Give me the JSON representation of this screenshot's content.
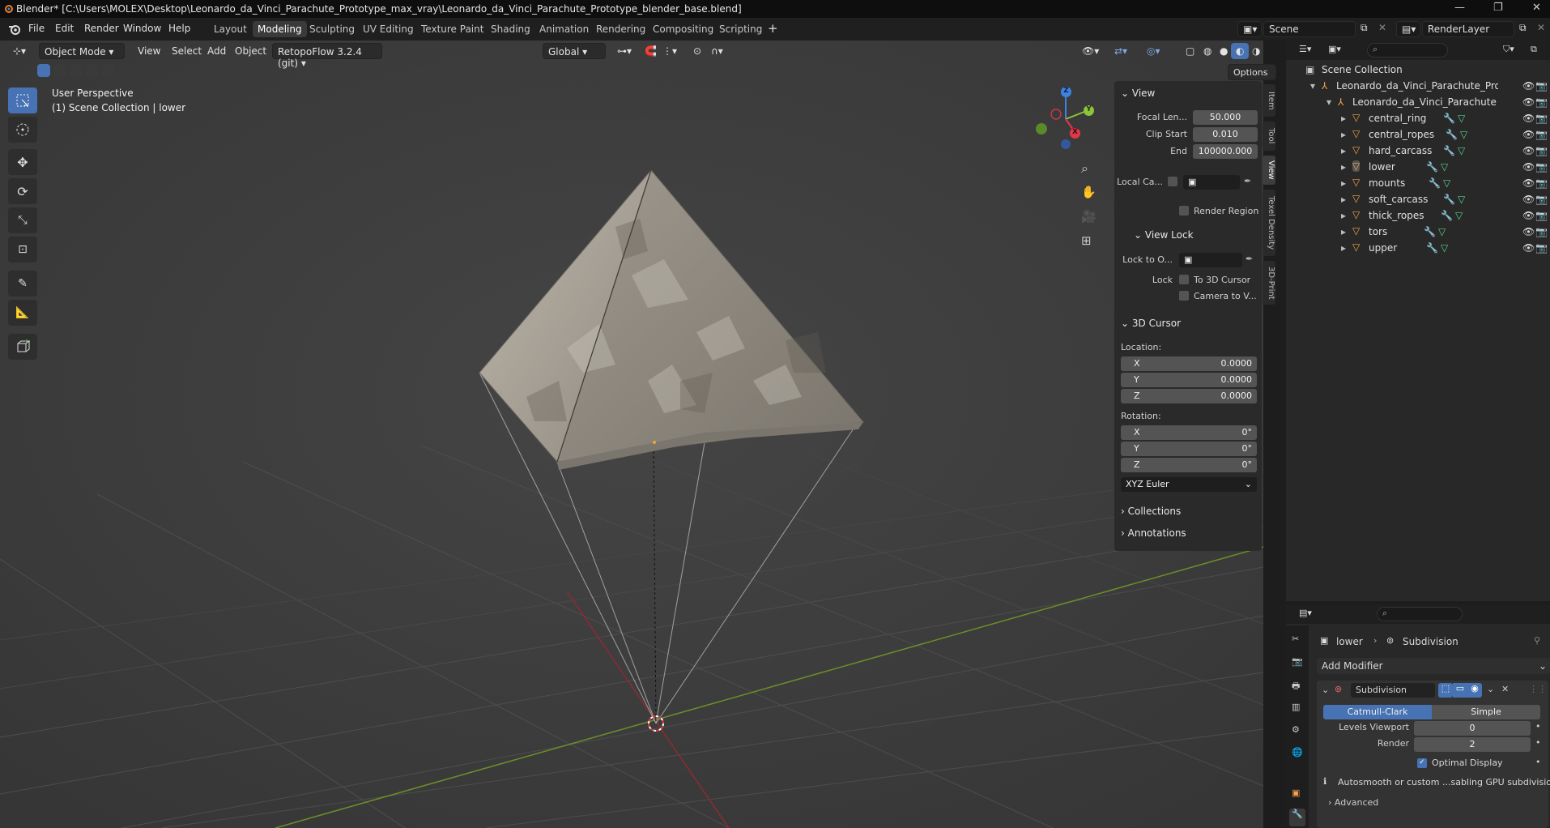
{
  "titlebar": {
    "title": "Blender* [C:\\Users\\MOLEX\\Desktop\\Leonardo_da_Vinci_Parachute_Prototype_max_vray\\Leonardo_da_Vinci_Parachute_Prototype_blender_base.blend]"
  },
  "menubar": {
    "items": [
      "File",
      "Edit",
      "Render",
      "Window",
      "Help"
    ],
    "workspaces": [
      "Layout",
      "Modeling",
      "Sculpting",
      "UV Editing",
      "Texture Paint",
      "Shading",
      "Animation",
      "Rendering",
      "Compositing",
      "Scripting"
    ],
    "active_workspace": "Modeling",
    "scene": "Scene",
    "render_layer": "RenderLayer"
  },
  "viewport_header": {
    "mode": "Object Mode",
    "menus": [
      "View",
      "Select",
      "Add",
      "Object"
    ],
    "addon": "RetopoFlow 3.2.4 (git)",
    "orientation": "Global",
    "options_label": "Options"
  },
  "viewport": {
    "perspective": "User Perspective",
    "collection_info": "(1) Scene Collection | lower",
    "gizmo": {
      "x": "X",
      "y": "Y",
      "z": "Z"
    },
    "colors": {
      "x_axis": "#e0384a",
      "y_axis": "#8cc43c",
      "z_axis": "#3f83e0"
    }
  },
  "npanel": {
    "view_header": "View",
    "focal_label": "Focal Len...",
    "focal_value": "50.000",
    "clip_start_label": "Clip Start",
    "clip_start_value": "0.010",
    "end_label": "End",
    "end_value": "100000.000",
    "local_camera_label": "Local Ca...",
    "render_region_label": "Render Region",
    "view_lock_header": "View Lock",
    "lock_to_object_label": "Lock to O...",
    "lock_label": "Lock",
    "to_3d_cursor_label": "To 3D Cursor",
    "camera_to_view_label": "Camera to V...",
    "cursor_header": "3D Cursor",
    "location_label": "Location:",
    "loc_x_label": "X",
    "loc_x": "0.0000",
    "loc_y_label": "Y",
    "loc_y": "0.0000",
    "loc_z_label": "Z",
    "loc_z": "0.0000",
    "rotation_label": "Rotation:",
    "rot_x_label": "X",
    "rot_x": "0°",
    "rot_y_label": "Y",
    "rot_y": "0°",
    "rot_z_label": "Z",
    "rot_z": "0°",
    "rotation_mode": "XYZ Euler",
    "collections_header": "Collections",
    "annotations_header": "Annotations",
    "tabs": [
      "Item",
      "Tool",
      "View",
      "Texel Density",
      "3D-Print"
    ]
  },
  "outliner": {
    "scene_collection": "Scene Collection",
    "root": "Leonardo_da_Vinci_Parachute_Prototyp",
    "child": "Leonardo_da_Vinci_Parachute",
    "objects": [
      "central_ring",
      "central_ropes",
      "hard_carcass",
      "lower",
      "mounts",
      "soft_carcass",
      "thick_ropes",
      "tors",
      "upper"
    ]
  },
  "properties": {
    "breadcrumb_object": "lower",
    "breadcrumb_modifier": "Subdivision",
    "add_modifier": "Add Modifier",
    "modifier_name": "Subdivision",
    "catmull_clark": "Catmull-Clark",
    "simple": "Simple",
    "levels_viewport_label": "Levels Viewport",
    "levels_viewport": "0",
    "render_label": "Render",
    "render_value": "2",
    "optimal_display": "Optimal Display",
    "info_text": "Autosmooth or custom ...sabling GPU subdivision",
    "advanced": "Advanced"
  }
}
